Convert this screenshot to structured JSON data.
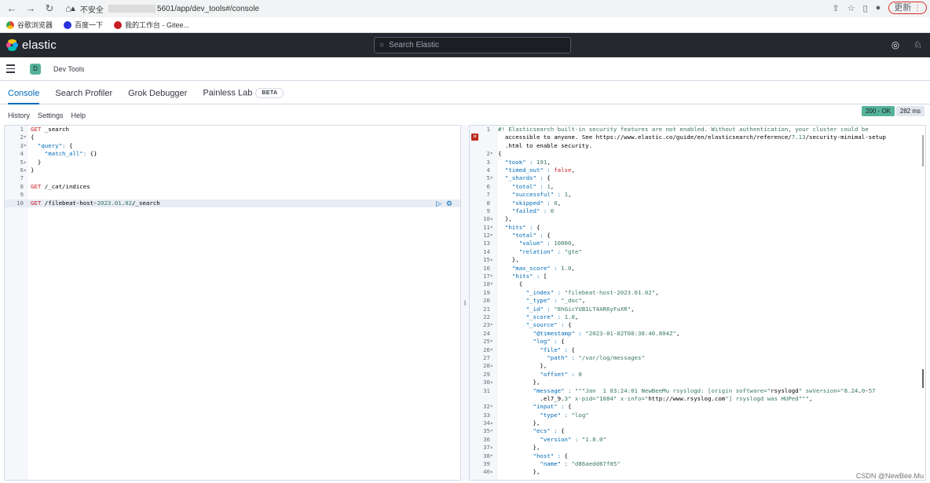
{
  "browser": {
    "insecure_label": "不安全",
    "url": "5601/app/dev_tools#/console",
    "update_label": "更新",
    "bookmarks": [
      "谷歌浏览器",
      "百度一下",
      "我的工作台 - Gitee..."
    ]
  },
  "header": {
    "logo_text": "elastic",
    "search_placeholder": "Search Elastic"
  },
  "breadcrumb": {
    "space_initial": "D",
    "title": "Dev Tools"
  },
  "tabs": [
    {
      "label": "Console"
    },
    {
      "label": "Search Profiler"
    },
    {
      "label": "Grok Debugger"
    },
    {
      "label": "Painless Lab"
    }
  ],
  "beta_label": "BETA",
  "toolbar": {
    "history": "History",
    "settings": "Settings",
    "help": "Help",
    "status": "200 - OK",
    "time": "282 ms"
  },
  "request_lines": [
    {
      "n": "1",
      "f": "",
      "t": "GET _search"
    },
    {
      "n": "2",
      "f": "▾",
      "t": "{"
    },
    {
      "n": "3",
      "f": "▾",
      "t": "  \"query\": {"
    },
    {
      "n": "4",
      "f": "",
      "t": "    \"match_all\": {}"
    },
    {
      "n": "5",
      "f": "▴",
      "t": "  }"
    },
    {
      "n": "6",
      "f": "▴",
      "t": "}"
    },
    {
      "n": "7",
      "f": "",
      "t": ""
    },
    {
      "n": "8",
      "f": "",
      "t": "GET /_cat/indices"
    },
    {
      "n": "9",
      "f": "",
      "t": ""
    },
    {
      "n": "10",
      "f": "",
      "t": "GET /filebeat-host-2023.01.02/_search"
    }
  ],
  "response_lines": [
    {
      "n": "1",
      "f": "",
      "t": "#! Elasticsearch built-in security features are not enabled. Without authentication, your cluster could be"
    },
    {
      "n": "",
      "f": "",
      "t": "  accessible to anyone. See https://www.elastic.co/guide/en/elasticsearch/reference/7.13/security-minimal-setup"
    },
    {
      "n": "",
      "f": "",
      "t": "  .html to enable security."
    },
    {
      "n": "2",
      "f": "▾",
      "t": "{"
    },
    {
      "n": "3",
      "f": "",
      "t": "  \"took\" : 191,"
    },
    {
      "n": "4",
      "f": "",
      "t": "  \"timed_out\" : false,"
    },
    {
      "n": "5",
      "f": "▾",
      "t": "  \"_shards\" : {"
    },
    {
      "n": "6",
      "f": "",
      "t": "    \"total\" : 1,"
    },
    {
      "n": "7",
      "f": "",
      "t": "    \"successful\" : 1,"
    },
    {
      "n": "8",
      "f": "",
      "t": "    \"skipped\" : 0,"
    },
    {
      "n": "9",
      "f": "",
      "t": "    \"failed\" : 0"
    },
    {
      "n": "10",
      "f": "▴",
      "t": "  },"
    },
    {
      "n": "11",
      "f": "▾",
      "t": "  \"hits\" : {"
    },
    {
      "n": "12",
      "f": "▾",
      "t": "    \"total\" : {"
    },
    {
      "n": "13",
      "f": "",
      "t": "      \"value\" : 10000,"
    },
    {
      "n": "14",
      "f": "",
      "t": "      \"relation\" : \"gte\""
    },
    {
      "n": "15",
      "f": "▴",
      "t": "    },"
    },
    {
      "n": "16",
      "f": "",
      "t": "    \"max_score\" : 1.0,"
    },
    {
      "n": "17",
      "f": "▾",
      "t": "    \"hits\" : ["
    },
    {
      "n": "18",
      "f": "▾",
      "t": "      {"
    },
    {
      "n": "19",
      "f": "",
      "t": "        \"_index\" : \"filebeat-host-2023.01.02\","
    },
    {
      "n": "20",
      "f": "",
      "t": "        \"_type\" : \"_doc\","
    },
    {
      "n": "21",
      "f": "",
      "t": "        \"_id\" : \"8hGicYUB1LT4AR6yFuXR\","
    },
    {
      "n": "22",
      "f": "",
      "t": "        \"_score\" : 1.0,"
    },
    {
      "n": "23",
      "f": "▾",
      "t": "        \"_source\" : {"
    },
    {
      "n": "24",
      "f": "",
      "t": "          \"@timestamp\" : \"2023-01-02T08:38:40.804Z\","
    },
    {
      "n": "25",
      "f": "▾",
      "t": "          \"log\" : {"
    },
    {
      "n": "26",
      "f": "▾",
      "t": "            \"file\" : {"
    },
    {
      "n": "27",
      "f": "",
      "t": "              \"path\" : \"/var/log/messages\""
    },
    {
      "n": "28",
      "f": "▴",
      "t": "            },"
    },
    {
      "n": "29",
      "f": "",
      "t": "            \"offset\" : 0"
    },
    {
      "n": "30",
      "f": "▴",
      "t": "          },"
    },
    {
      "n": "31",
      "f": "",
      "t": "          \"message\" : \"\"\"Jan  1 03:24:01 NewBeeMu rsyslogd: [origin software=\"rsyslogd\" swVersion=\"8.24.0-57"
    },
    {
      "n": "",
      "f": "",
      "t": "            .el7_9.3\" x-pid=\"1084\" x-info=\"http://www.rsyslog.com\"] rsyslogd was HUPed\"\"\","
    },
    {
      "n": "32",
      "f": "▾",
      "t": "          \"input\" : {"
    },
    {
      "n": "33",
      "f": "",
      "t": "            \"type\" : \"log\""
    },
    {
      "n": "34",
      "f": "▴",
      "t": "          },"
    },
    {
      "n": "35",
      "f": "▾",
      "t": "          \"ecs\" : {"
    },
    {
      "n": "36",
      "f": "",
      "t": "            \"version\" : \"1.8.0\""
    },
    {
      "n": "37",
      "f": "▴",
      "t": "          },"
    },
    {
      "n": "38",
      "f": "▾",
      "t": "          \"host\" : {"
    },
    {
      "n": "39",
      "f": "",
      "t": "            \"name\" : \"d86aedd67f05\""
    },
    {
      "n": "40",
      "f": "▴",
      "t": "          },"
    }
  ],
  "watermark": "CSDN @NewBee.Mu"
}
